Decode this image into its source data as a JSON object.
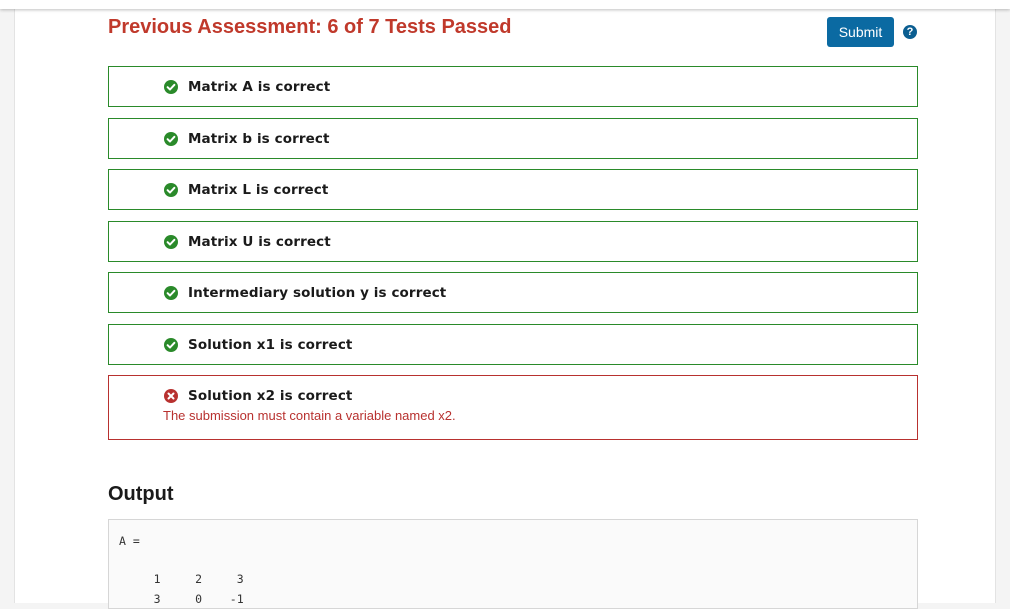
{
  "assessment": {
    "title": "Previous Assessment: 6 of 7 Tests Passed",
    "submit_label": "Submit",
    "help_icon": "question-circle-icon",
    "colors": {
      "title": "#c0392b",
      "submit_bg": "#0b6aa2",
      "pass": "#2a8a2a",
      "fail": "#b8312f"
    }
  },
  "tests": [
    {
      "label": "Matrix A is correct",
      "status": "pass",
      "icon": "check-circle-icon"
    },
    {
      "label": "Matrix b is correct",
      "status": "pass",
      "icon": "check-circle-icon"
    },
    {
      "label": "Matrix L is correct",
      "status": "pass",
      "icon": "check-circle-icon"
    },
    {
      "label": "Matrix U is correct",
      "status": "pass",
      "icon": "check-circle-icon"
    },
    {
      "label": "Intermediary solution y is correct",
      "status": "pass",
      "icon": "check-circle-icon"
    },
    {
      "label": "Solution x1 is correct",
      "status": "pass",
      "icon": "check-circle-icon"
    },
    {
      "label": "Solution x2 is correct",
      "status": "fail",
      "icon": "x-circle-icon",
      "message": "The submission must contain a variable named x2."
    }
  ],
  "output": {
    "heading": "Output",
    "lines": [
      "A =",
      "",
      "     1     2     3",
      "     3     0    -1"
    ]
  }
}
